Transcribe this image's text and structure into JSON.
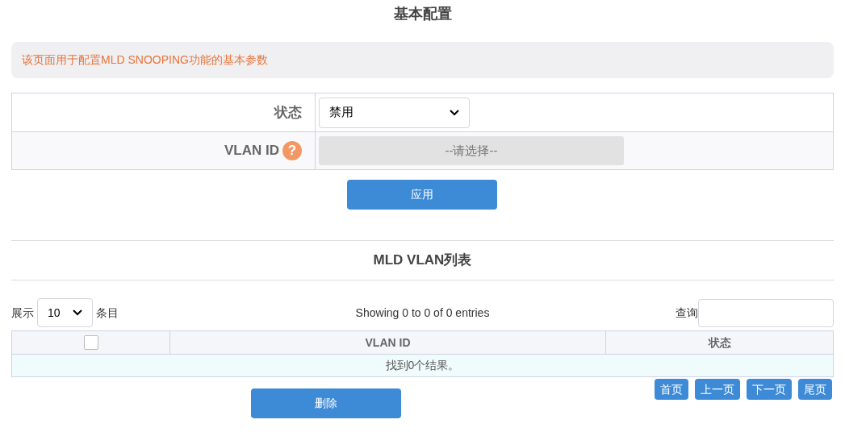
{
  "title": "基本配置",
  "notice": "该页面用于配置MLD SNOOPING功能的基本参数",
  "form": {
    "status": {
      "label": "状态",
      "value": "禁用"
    },
    "vlan_id": {
      "label": "VLAN ID",
      "help": "?",
      "placeholder": "--请选择--",
      "disabled": true
    }
  },
  "apply_button": "应用",
  "list": {
    "title": "MLD VLAN列表",
    "page_size": {
      "prefix": "展示",
      "value": "10",
      "suffix": "条目"
    },
    "info": "Showing 0 to 0 of 0 entries",
    "search": {
      "label": "查询"
    },
    "table": {
      "select_all": {
        "checked": false
      },
      "columns": [
        "VLAN ID",
        "状态"
      ],
      "empty": "找到0个结果。"
    },
    "delete_button": "删除",
    "pagination": [
      "首页",
      "上一页",
      "下一页",
      "尾页"
    ]
  }
}
